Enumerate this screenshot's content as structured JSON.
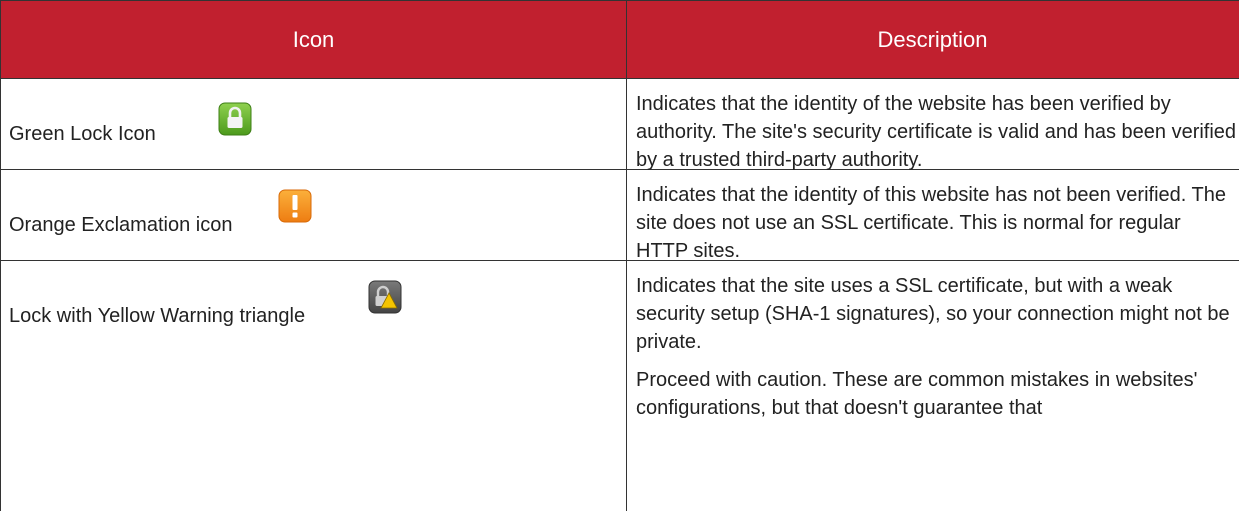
{
  "colors": {
    "header_bg": "#c1202f",
    "header_text": "#ffffff",
    "border": "#333333",
    "body_text": "#222222"
  },
  "table": {
    "headers": [
      "Icon",
      "Description"
    ],
    "rows": [
      {
        "label": "Green Lock Icon",
        "icon": "green-lock-icon",
        "description": [
          "Indicates that the identity of the website has been verified by authority. The site's security certificate is valid and has been verified by a trusted third-party authority."
        ]
      },
      {
        "label": "Orange Exclamation icon",
        "icon": "orange-exclamation-icon",
        "description": [
          "Indicates that the identity of this website has not been verified. The site does not use an SSL certificate. This is normal for regular HTTP sites."
        ]
      },
      {
        "label": "Lock with Yellow Warning triangle",
        "icon": "lock-warning-triangle-icon",
        "description": [
          "Indicates that the site uses a SSL certificate, but with a weak security setup (SHA-1 signatures), so your connection might not be private.",
          "Proceed with caution. These are common mistakes in websites' configurations, but that doesn't guarantee that"
        ]
      }
    ]
  }
}
